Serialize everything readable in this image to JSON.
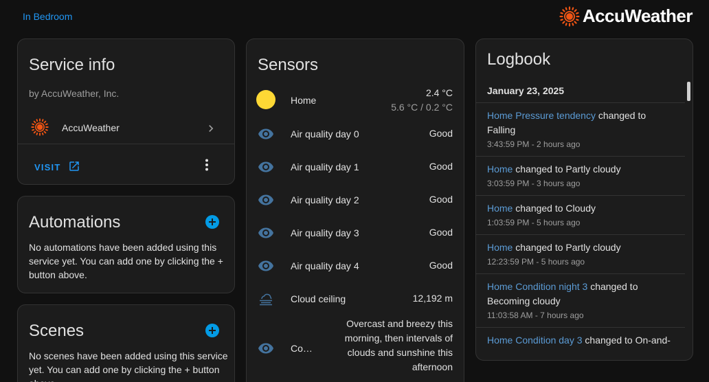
{
  "breadcrumb": "In Bedroom",
  "brand": {
    "name": "AccuWeather",
    "color": "#f05514"
  },
  "service_info": {
    "title": "Service info",
    "by": "by AccuWeather, Inc.",
    "integration_name": "AccuWeather",
    "visit_label": "VISIT"
  },
  "automations": {
    "title": "Automations",
    "text": "No automations have been added using this service yet. You can add one by clicking the + button above."
  },
  "scenes": {
    "title": "Scenes",
    "text": "No scenes have been added using this service yet. You can add one by clicking the + button above."
  },
  "sensors": {
    "title": "Sensors",
    "items": [
      {
        "icon": "sun-icon",
        "label": "Home",
        "value": "2.4 °C",
        "sub": "5.6 °C / 0.2 °C"
      },
      {
        "icon": "eye-icon",
        "label": "Air quality day 0",
        "value": "Good"
      },
      {
        "icon": "eye-icon",
        "label": "Air quality day 1",
        "value": "Good"
      },
      {
        "icon": "eye-icon",
        "label": "Air quality day 2",
        "value": "Good"
      },
      {
        "icon": "eye-icon",
        "label": "Air quality day 3",
        "value": "Good"
      },
      {
        "icon": "eye-icon",
        "label": "Air quality day 4",
        "value": "Good"
      },
      {
        "icon": "weather-fog-icon",
        "label": "Cloud ceiling",
        "value": "12,192 m"
      },
      {
        "icon": "eye-icon",
        "label": "Co…",
        "value": "Overcast and breezy this morning, then intervals of clouds and sunshine this afternoon"
      }
    ]
  },
  "logbook": {
    "title": "Logbook",
    "date": "January 23, 2025",
    "entries": [
      {
        "entity": "Home Pressure tendency",
        "action": " changed to Falling",
        "time": "3:43:59 PM - 2 hours ago"
      },
      {
        "entity": "Home",
        "action": " changed to Partly cloudy",
        "time": "3:03:59 PM - 3 hours ago"
      },
      {
        "entity": "Home",
        "action": " changed to Cloudy",
        "time": "1:03:59 PM - 5 hours ago"
      },
      {
        "entity": "Home",
        "action": " changed to Partly cloudy",
        "time": "12:23:59 PM - 5 hours ago"
      },
      {
        "entity": "Home Condition night 3",
        "action": " changed to Becoming cloudy",
        "time": "11:03:58 AM - 7 hours ago"
      },
      {
        "entity": "Home Condition day 3",
        "action": " changed to On-and-",
        "time": ""
      }
    ]
  },
  "colors": {
    "accent": "#2196f3",
    "icon_blue": "#44739e",
    "sun": "#fdd835",
    "add": "#039be5"
  }
}
